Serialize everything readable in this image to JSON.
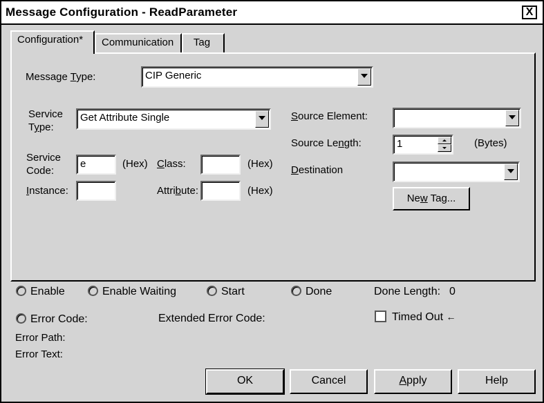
{
  "window": {
    "title": "Message Configuration - ReadParameter",
    "close_glyph": "X"
  },
  "tabs": [
    {
      "label": "Configuration*",
      "active": true
    },
    {
      "label": "Communication",
      "active": false
    },
    {
      "label": "Tag",
      "active": false
    }
  ],
  "config": {
    "message_type_label": "Message Type:",
    "message_type_value": "CIP Generic",
    "service_type_label_1": "Service",
    "service_type_label_2": "Type:",
    "service_type_value": "Get Attribute Single",
    "service_code_label_1": "Service",
    "service_code_label_2": "Code:",
    "service_code_value": "e",
    "hex_label": "(Hex)",
    "class_label": "Class:",
    "class_value": "",
    "instance_label": "Instance:",
    "instance_value": "",
    "attribute_label": "Attribute:",
    "attribute_value": "",
    "source_element_label": "Source Element:",
    "source_element_value": "",
    "source_length_label": "Source Length:",
    "source_length_value": "1",
    "bytes_label": "(Bytes)",
    "destination_label": "Destination",
    "destination_value": "",
    "new_tag_label": "New Tag..."
  },
  "status": {
    "enable": "Enable",
    "enable_waiting": "Enable Waiting",
    "start": "Start",
    "done": "Done",
    "done_length_label": "Done Length:",
    "done_length_value": "0",
    "error_code_label": "Error Code:",
    "extended_error_code_label": "Extended Error Code:",
    "timed_out_label": "Timed Out",
    "timed_out_arrow": "←",
    "error_path_label": "Error Path:",
    "error_text_label": "Error Text:"
  },
  "buttons": {
    "ok": "OK",
    "cancel": "Cancel",
    "apply": "Apply",
    "help": "Help"
  }
}
